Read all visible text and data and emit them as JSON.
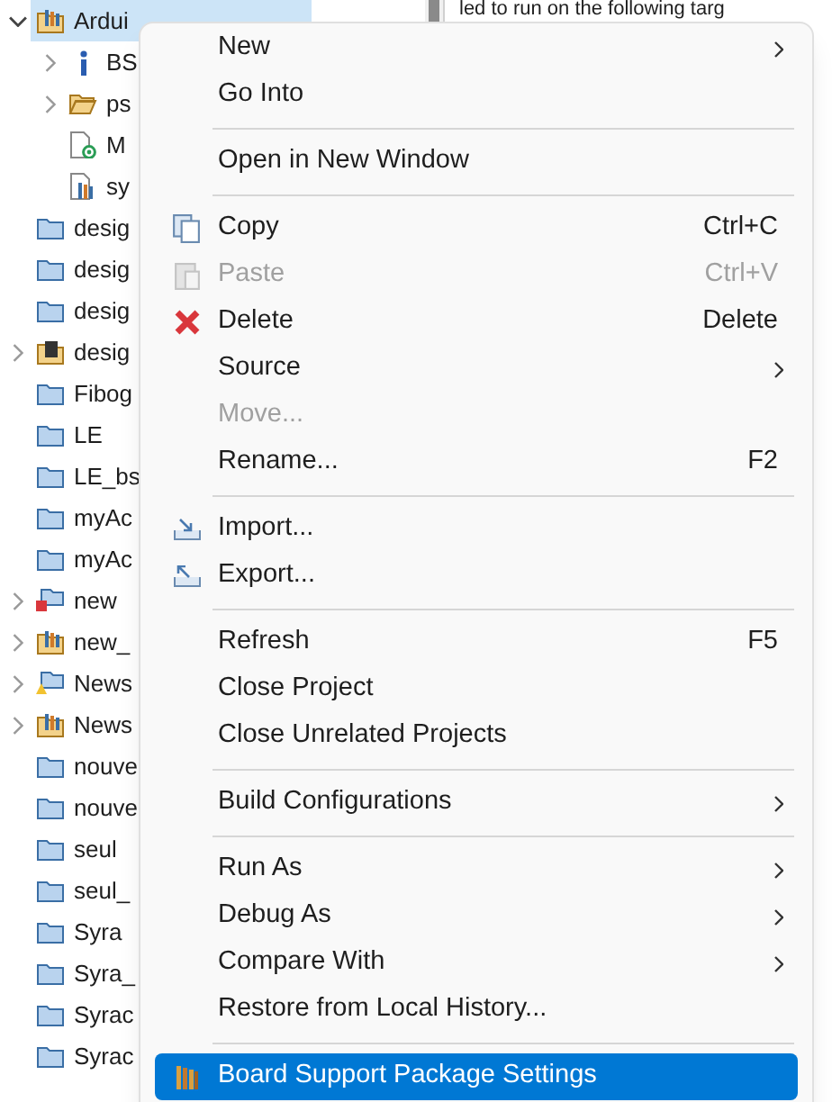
{
  "tree": [
    {
      "label": "Ardui",
      "kind": "arduino",
      "expanded": true,
      "selected": true,
      "children": [
        {
          "label": "BS",
          "kind": "info",
          "expanded": false,
          "selected": false
        },
        {
          "label": "ps",
          "kind": "folder",
          "expanded": false,
          "selected": false
        },
        {
          "label": "M",
          "kind": "file",
          "selected": false
        },
        {
          "label": "sy",
          "kind": "library",
          "selected": false
        }
      ]
    },
    {
      "label": "desig",
      "kind": "project",
      "selected": false
    },
    {
      "label": "desig",
      "kind": "project",
      "selected": false
    },
    {
      "label": "desig",
      "kind": "project",
      "selected": false
    },
    {
      "label": "desig",
      "kind": "chip",
      "expanded": false,
      "selected": false
    },
    {
      "label": "Fibog",
      "kind": "project",
      "selected": false
    },
    {
      "label": "LE",
      "kind": "project",
      "selected": false
    },
    {
      "label": "LE_bs",
      "kind": "project",
      "selected": false
    },
    {
      "label": "myAc",
      "kind": "project",
      "selected": false
    },
    {
      "label": "myAc",
      "kind": "project",
      "selected": false
    },
    {
      "label": "new",
      "kind": "error",
      "expanded": false,
      "selected": false
    },
    {
      "label": "new_",
      "kind": "arduino",
      "expanded": false,
      "selected": false
    },
    {
      "label": "News",
      "kind": "warning",
      "expanded": false,
      "selected": false
    },
    {
      "label": "News",
      "kind": "arduino",
      "expanded": false,
      "selected": false
    },
    {
      "label": "nouve",
      "kind": "project",
      "selected": false
    },
    {
      "label": "nouve",
      "kind": "project",
      "selected": false
    },
    {
      "label": "seul",
      "kind": "project",
      "selected": false
    },
    {
      "label": "seul_",
      "kind": "project",
      "selected": false
    },
    {
      "label": "Syra",
      "kind": "project",
      "selected": false
    },
    {
      "label": "Syra_",
      "kind": "project",
      "selected": false
    },
    {
      "label": "Syrac",
      "kind": "project",
      "selected": false
    },
    {
      "label": "Syrac",
      "kind": "project",
      "selected": false
    }
  ],
  "editor": {
    "text": "led to run on the following targ"
  },
  "menu": [
    {
      "kind": "item",
      "label": "New",
      "submenu": true,
      "disabled": false,
      "selected": false
    },
    {
      "kind": "item",
      "label": "Go Into",
      "submenu": false,
      "disabled": false,
      "selected": false
    },
    {
      "kind": "separator"
    },
    {
      "kind": "item",
      "label": "Open in New Window",
      "submenu": false,
      "disabled": false,
      "selected": false
    },
    {
      "kind": "separator"
    },
    {
      "kind": "item",
      "label": "Copy",
      "shortcut": "Ctrl+C",
      "submenu": false,
      "disabled": false,
      "selected": false
    },
    {
      "kind": "item",
      "label": "Paste",
      "shortcut": "Ctrl+V",
      "submenu": false,
      "disabled": true,
      "selected": false
    },
    {
      "kind": "item",
      "label": "Delete",
      "shortcut": "Delete",
      "submenu": false,
      "disabled": false,
      "selected": false
    },
    {
      "kind": "item",
      "label": "Source",
      "submenu": true,
      "disabled": false,
      "selected": false
    },
    {
      "kind": "item",
      "label": "Move...",
      "submenu": false,
      "disabled": true,
      "selected": false
    },
    {
      "kind": "item",
      "label": "Rename...",
      "shortcut": "F2",
      "submenu": false,
      "disabled": false,
      "selected": false
    },
    {
      "kind": "separator"
    },
    {
      "kind": "item",
      "label": "Import...",
      "submenu": false,
      "disabled": false,
      "selected": false
    },
    {
      "kind": "item",
      "label": "Export...",
      "submenu": false,
      "disabled": false,
      "selected": false
    },
    {
      "kind": "separator"
    },
    {
      "kind": "item",
      "label": "Refresh",
      "shortcut": "F5",
      "submenu": false,
      "disabled": false,
      "selected": false
    },
    {
      "kind": "item",
      "label": "Close Project",
      "submenu": false,
      "disabled": false,
      "selected": false
    },
    {
      "kind": "item",
      "label": "Close Unrelated Projects",
      "submenu": false,
      "disabled": false,
      "selected": false
    },
    {
      "kind": "separator"
    },
    {
      "kind": "item",
      "label": "Build Configurations",
      "submenu": true,
      "disabled": false,
      "selected": false
    },
    {
      "kind": "separator"
    },
    {
      "kind": "item",
      "label": "Run As",
      "submenu": true,
      "disabled": false,
      "selected": false
    },
    {
      "kind": "item",
      "label": "Debug As",
      "submenu": true,
      "disabled": false,
      "selected": false
    },
    {
      "kind": "item",
      "label": "Compare With",
      "submenu": true,
      "disabled": false,
      "selected": false
    },
    {
      "kind": "item",
      "label": "Restore from Local History...",
      "submenu": false,
      "disabled": false,
      "selected": false
    },
    {
      "kind": "separator"
    },
    {
      "kind": "item",
      "label": "Board Support Package Settings",
      "submenu": false,
      "disabled": false,
      "selected": true
    }
  ]
}
